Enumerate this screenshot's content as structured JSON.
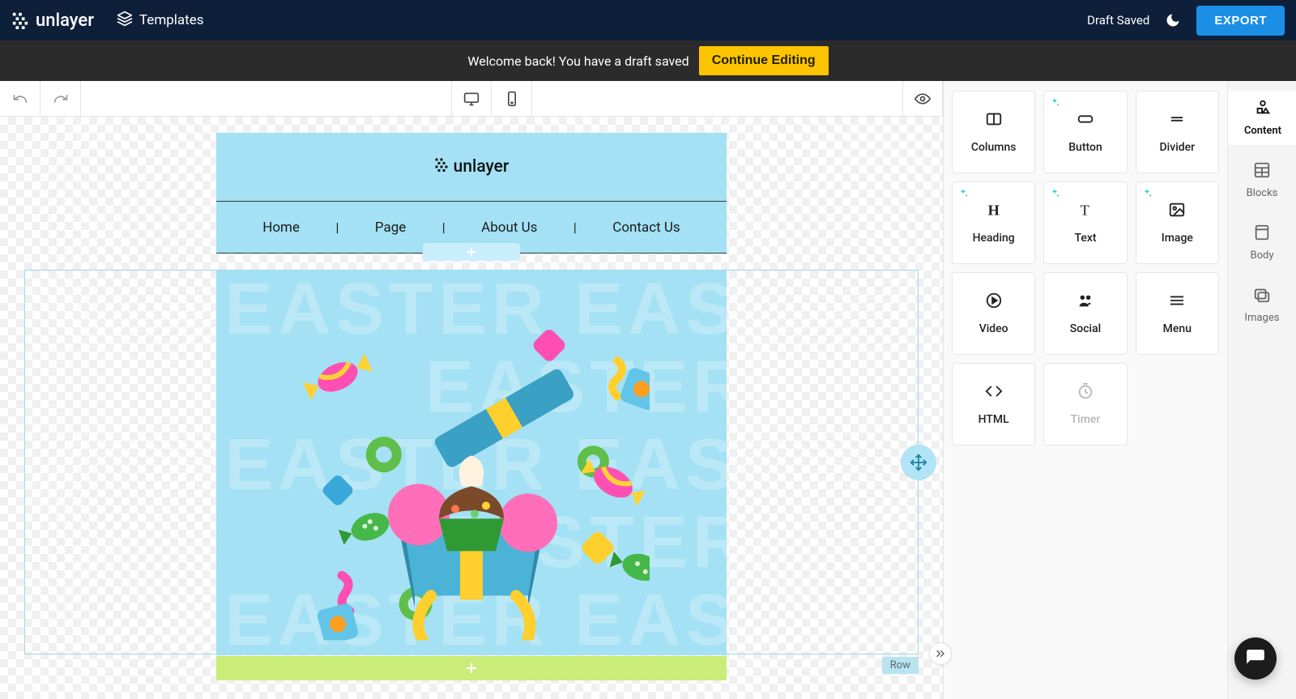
{
  "brand": "unlayer",
  "header": {
    "templates_label": "Templates",
    "draft_saved": "Draft Saved",
    "export_label": "EXPORT"
  },
  "notice": {
    "text": "Welcome back! You have a draft saved",
    "cta": "Continue Editing"
  },
  "email": {
    "logo_text": "unlayer",
    "nav": [
      "Home",
      "Page",
      "About Us",
      "Contact Us"
    ],
    "bg_word": "EASTER",
    "row_label": "Row"
  },
  "panel": {
    "tools": [
      {
        "key": "columns",
        "label": "Columns",
        "sparkle": false
      },
      {
        "key": "button",
        "label": "Button",
        "sparkle": true
      },
      {
        "key": "divider",
        "label": "Divider",
        "sparkle": false
      },
      {
        "key": "heading",
        "label": "Heading",
        "sparkle": true
      },
      {
        "key": "text",
        "label": "Text",
        "sparkle": true
      },
      {
        "key": "image",
        "label": "Image",
        "sparkle": true
      },
      {
        "key": "video",
        "label": "Video",
        "sparkle": false
      },
      {
        "key": "social",
        "label": "Social",
        "sparkle": false
      },
      {
        "key": "menu",
        "label": "Menu",
        "sparkle": false
      },
      {
        "key": "html",
        "label": "HTML",
        "sparkle": false
      },
      {
        "key": "timer",
        "label": "Timer",
        "sparkle": false,
        "disabled": true
      }
    ]
  },
  "rail": {
    "active": "Content",
    "tabs": [
      "Content",
      "Blocks",
      "Body",
      "Images"
    ]
  },
  "colors": {
    "accent": "#1b8fe6",
    "warning": "#fdc500",
    "canvas_bg": "#a4e1f4"
  }
}
